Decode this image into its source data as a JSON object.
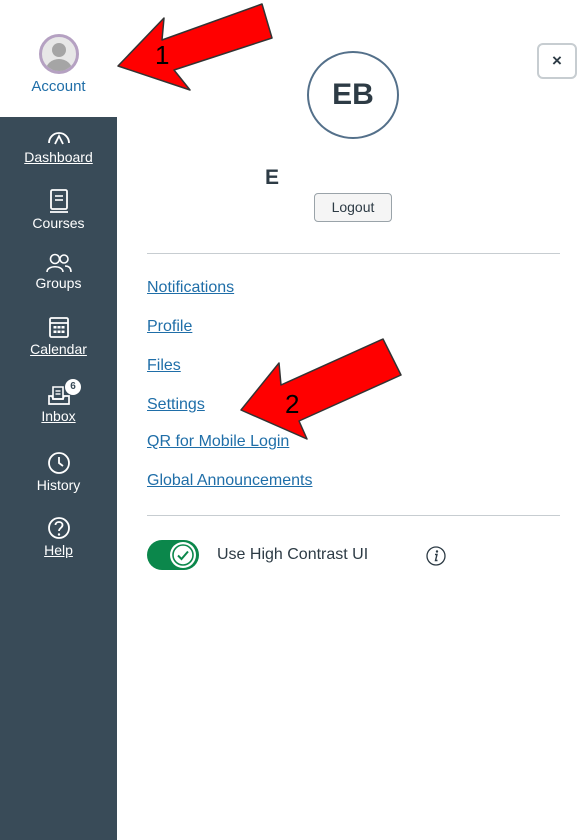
{
  "nav": {
    "account": {
      "label": "Account",
      "icon": "user-avatar-icon"
    },
    "items": [
      {
        "label": "Dashboard",
        "icon": "dashboard-icon",
        "underlined": true
      },
      {
        "label": "Courses",
        "icon": "courses-icon",
        "underlined": false
      },
      {
        "label": "Groups",
        "icon": "groups-icon",
        "underlined": false
      },
      {
        "label": "Calendar",
        "icon": "calendar-icon",
        "underlined": true
      },
      {
        "label": "Inbox",
        "icon": "inbox-icon",
        "underlined": true,
        "badge": "6"
      },
      {
        "label": "History",
        "icon": "history-icon",
        "underlined": false
      },
      {
        "label": "Help",
        "icon": "help-icon",
        "underlined": true
      }
    ],
    "background": "#394b58"
  },
  "tray": {
    "close_label": "×",
    "initials": "EB",
    "user_name": "E",
    "logout_label": "Logout",
    "links": [
      "Notifications",
      "Profile",
      "Files",
      "Settings",
      "QR for Mobile Login",
      "Global Announcements"
    ],
    "high_contrast_label": "Use High Contrast UI",
    "high_contrast_on": true,
    "info_icon": "info-icon",
    "link_color": "#1f6ea8",
    "toggle_color": "#0b874b"
  },
  "annotations": {
    "arrow1_label": "1",
    "arrow2_label": "2",
    "arrow_color": "#ff0000"
  }
}
